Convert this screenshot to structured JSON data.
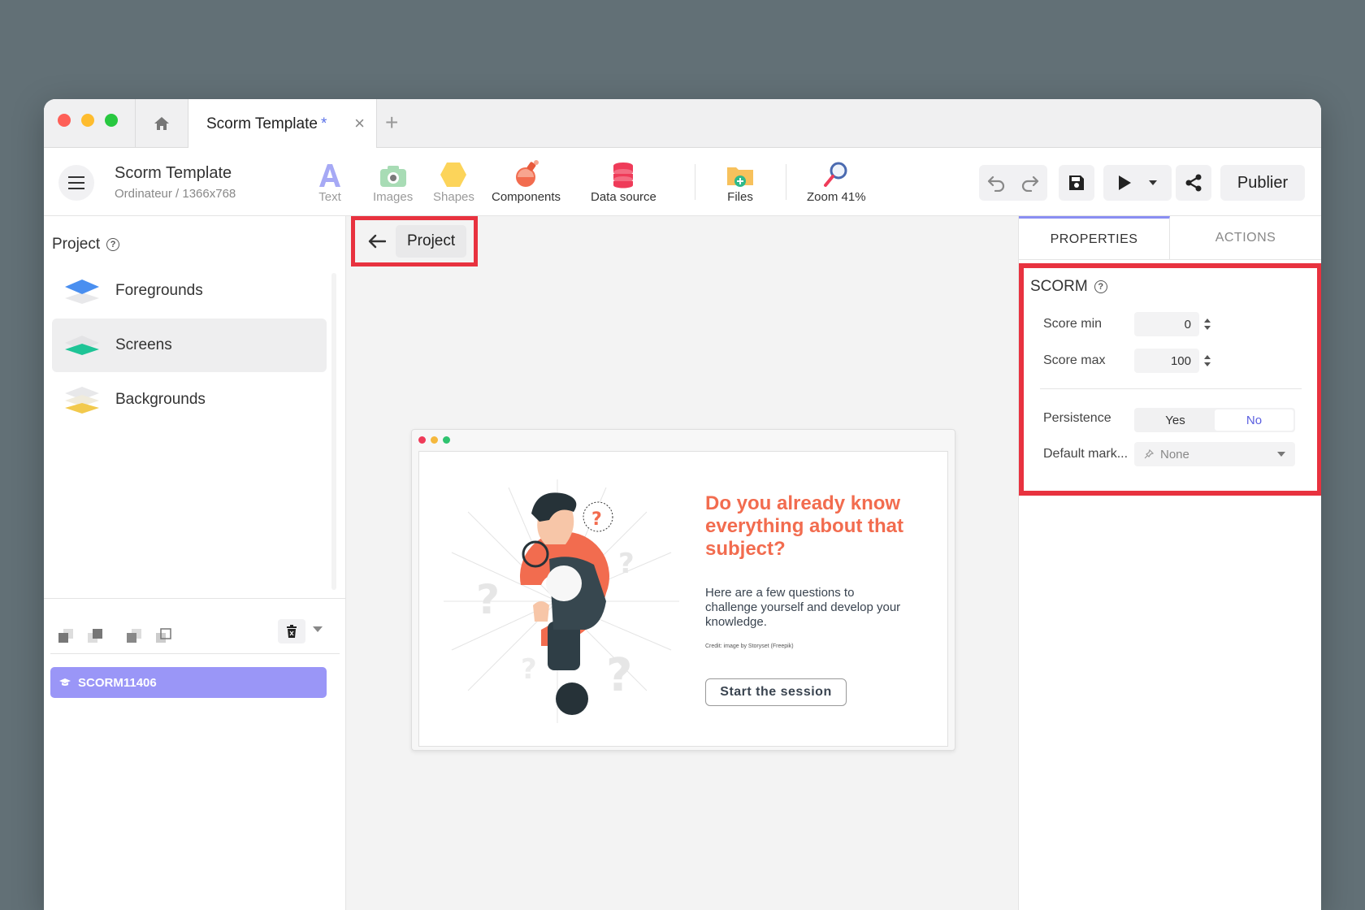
{
  "tab": {
    "title": "Scorm Template",
    "modified_mark": "*"
  },
  "toolbar": {
    "project_name": "Scorm Template",
    "project_sub": "Ordinateur / 1366x768",
    "tools": {
      "text": "Text",
      "images": "Images",
      "shapes": "Shapes",
      "components": "Components",
      "data_source": "Data source",
      "files": "Files",
      "zoom": "Zoom 41%"
    },
    "publish_label": "Publier"
  },
  "left_panel": {
    "title": "Project",
    "items": [
      {
        "label": "Foregrounds",
        "color": "#4a8ff0"
      },
      {
        "label": "Screens",
        "color": "#1ec496"
      },
      {
        "label": "Backgrounds",
        "color": "#f2c94c"
      }
    ],
    "object_label": "SCORM11406"
  },
  "canvas": {
    "nav_label": "Project",
    "preview": {
      "heading": "Do you already know everything about that subject?",
      "body": "Here are a few questions to challenge yourself and develop your knowledge.",
      "credit": "Credit: image by Storyset (Freepik)",
      "button": "Start the session"
    }
  },
  "right_panel": {
    "tabs": {
      "properties": "PROPERTIES",
      "actions": "ACTIONS"
    },
    "section_title": "SCORM",
    "score_min_label": "Score min",
    "score_min_value": "0",
    "score_max_label": "Score max",
    "score_max_value": "100",
    "persistence_label": "Persistence",
    "persistence_yes": "Yes",
    "persistence_no": "No",
    "default_marker_label": "Default mark...",
    "default_marker_value": "None"
  },
  "colors": {
    "accent": "#8a8ef2",
    "highlight": "#e8323f",
    "heading": "#f26c4f"
  }
}
